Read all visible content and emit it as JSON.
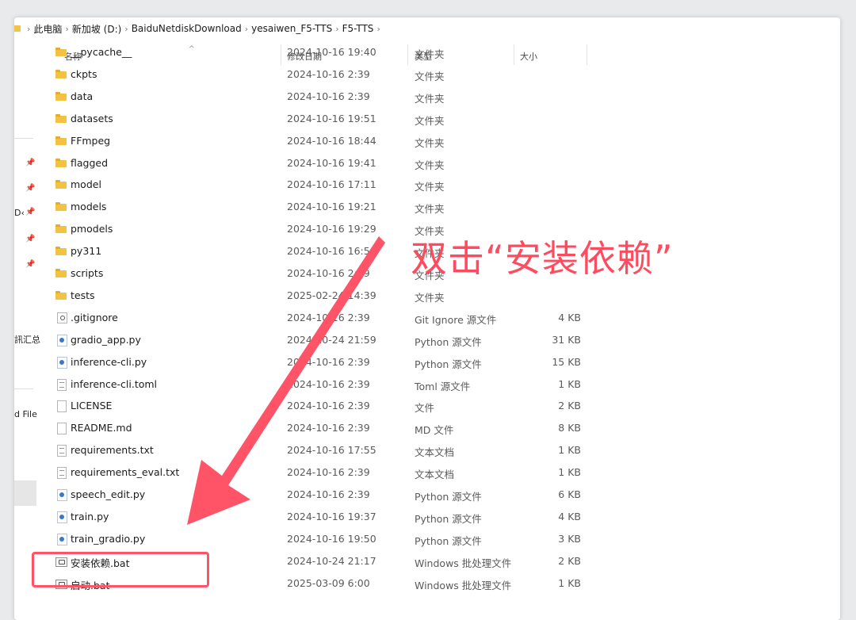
{
  "breadcrumb": [
    "此电脑",
    "新加坡 (D:)",
    "BaiduNetdiskDownload",
    "yesaiwen_F5-TTS",
    "F5-TTS"
  ],
  "nav_fragments": [
    "D‹",
    "訊汇总",
    "d File"
  ],
  "columns": {
    "name": "名称",
    "date": "修改日期",
    "type": "类型",
    "size": "大小"
  },
  "files": [
    {
      "name": "__pycache__",
      "date": "2024-10-16 19:40",
      "type": "文件夹",
      "size": "",
      "icon": "folder-icon"
    },
    {
      "name": "ckpts",
      "date": "2024-10-16 2:39",
      "type": "文件夹",
      "size": "",
      "icon": "folder-icon"
    },
    {
      "name": "data",
      "date": "2024-10-16 2:39",
      "type": "文件夹",
      "size": "",
      "icon": "folder-icon"
    },
    {
      "name": "datasets",
      "date": "2024-10-16 19:51",
      "type": "文件夹",
      "size": "",
      "icon": "folder-icon"
    },
    {
      "name": "FFmpeg",
      "date": "2024-10-16 18:44",
      "type": "文件夹",
      "size": "",
      "icon": "folder-icon"
    },
    {
      "name": "flagged",
      "date": "2024-10-16 19:41",
      "type": "文件夹",
      "size": "",
      "icon": "folder-icon"
    },
    {
      "name": "model",
      "date": "2024-10-16 17:11",
      "type": "文件夹",
      "size": "",
      "icon": "folder-icon"
    },
    {
      "name": "models",
      "date": "2024-10-16 19:21",
      "type": "文件夹",
      "size": "",
      "icon": "folder-icon"
    },
    {
      "name": "pmodels",
      "date": "2024-10-16 19:29",
      "type": "文件夹",
      "size": "",
      "icon": "folder-icon"
    },
    {
      "name": "py311",
      "date": "2024-10-16 16:54",
      "type": "文件夹",
      "size": "",
      "icon": "folder-icon"
    },
    {
      "name": "scripts",
      "date": "2024-10-16 2:39",
      "type": "文件夹",
      "size": "",
      "icon": "folder-icon"
    },
    {
      "name": "tests",
      "date": "2025-02-24 14:39",
      "type": "文件夹",
      "size": "",
      "icon": "folder-icon"
    },
    {
      "name": ".gitignore",
      "date": "2024-10-16 2:39",
      "type": "Git Ignore 源文件",
      "size": "4 KB",
      "icon": "gear-file-icon"
    },
    {
      "name": "gradio_app.py",
      "date": "2024-10-24 21:59",
      "type": "Python 源文件",
      "size": "31 KB",
      "icon": "python-file-icon"
    },
    {
      "name": "inference-cli.py",
      "date": "2024-10-16 2:39",
      "type": "Python 源文件",
      "size": "15 KB",
      "icon": "python-file-icon"
    },
    {
      "name": "inference-cli.toml",
      "date": "2024-10-16 2:39",
      "type": "Toml 源文件",
      "size": "1 KB",
      "icon": "text-file-icon"
    },
    {
      "name": "LICENSE",
      "date": "2024-10-16 2:39",
      "type": "文件",
      "size": "2 KB",
      "icon": "blank-file-icon"
    },
    {
      "name": "README.md",
      "date": "2024-10-16 2:39",
      "type": "MD 文件",
      "size": "8 KB",
      "icon": "blank-file-icon"
    },
    {
      "name": "requirements.txt",
      "date": "2024-10-16 17:55",
      "type": "文本文档",
      "size": "1 KB",
      "icon": "text-file-icon"
    },
    {
      "name": "requirements_eval.txt",
      "date": "2024-10-16 2:39",
      "type": "文本文档",
      "size": "1 KB",
      "icon": "text-file-icon"
    },
    {
      "name": "speech_edit.py",
      "date": "2024-10-16 2:39",
      "type": "Python 源文件",
      "size": "6 KB",
      "icon": "python-file-icon"
    },
    {
      "name": "train.py",
      "date": "2024-10-16 19:37",
      "type": "Python 源文件",
      "size": "4 KB",
      "icon": "python-file-icon"
    },
    {
      "name": "train_gradio.py",
      "date": "2024-10-16 19:50",
      "type": "Python 源文件",
      "size": "3 KB",
      "icon": "python-file-icon"
    },
    {
      "name": "安装依赖.bat",
      "date": "2024-10-24 21:17",
      "type": "Windows 批处理文件",
      "size": "2 KB",
      "icon": "batch-file-icon"
    },
    {
      "name": "启动.bat",
      "date": "2025-03-09 6:00",
      "type": "Windows 批处理文件",
      "size": "1 KB",
      "icon": "batch-file-icon"
    }
  ],
  "annotation": {
    "text": "双击“安装依赖”",
    "color": "#ff4b5f"
  }
}
